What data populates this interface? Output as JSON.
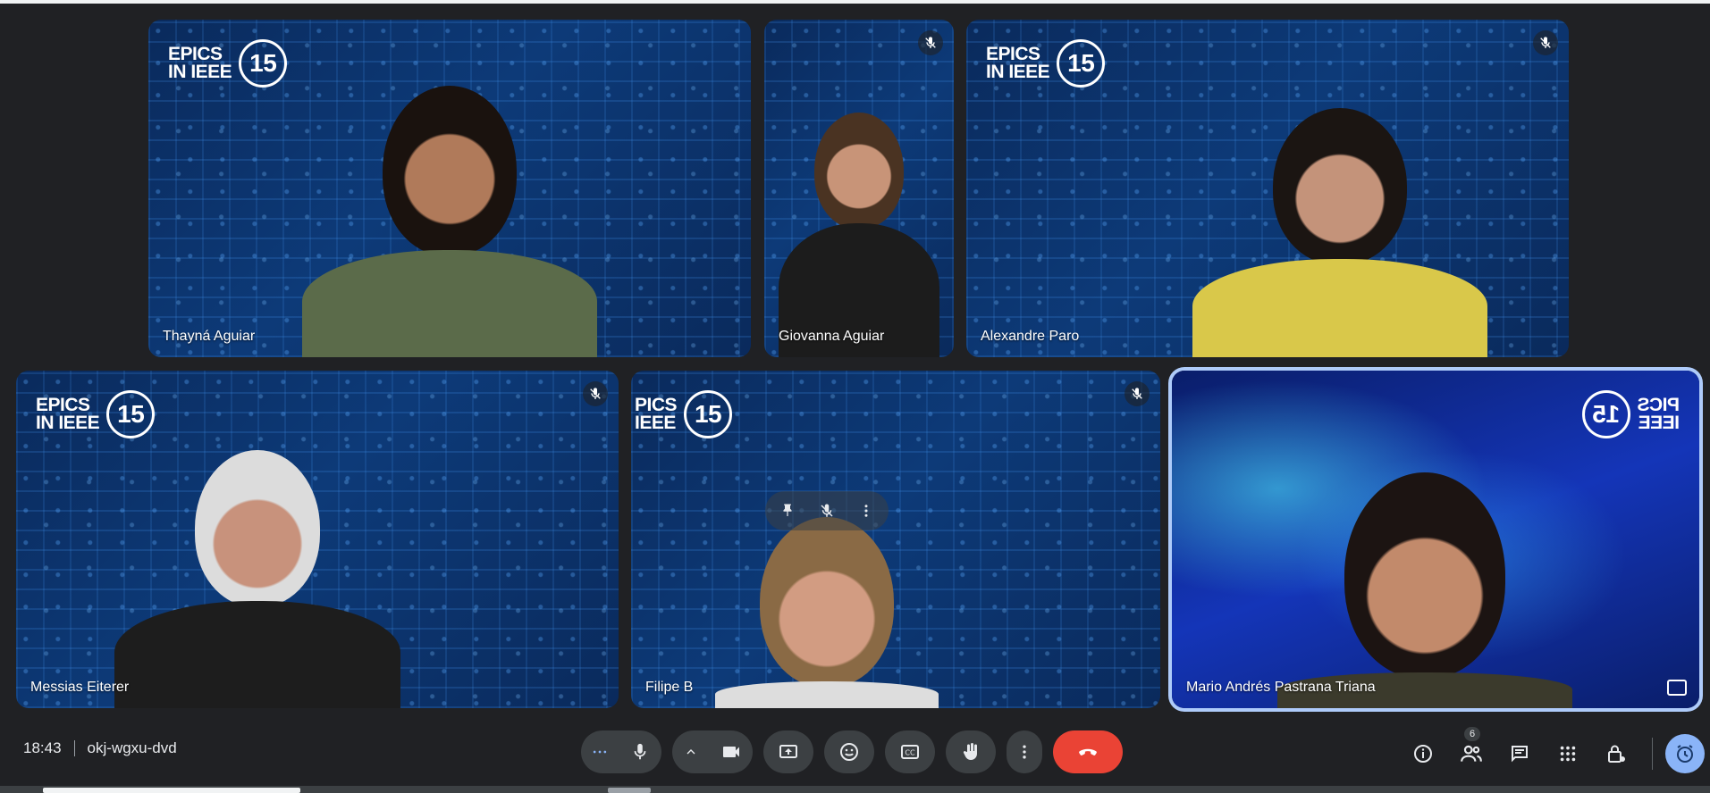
{
  "participants": [
    {
      "name": "Thayná Aguiar",
      "muted": false,
      "logo_top": "EPICS",
      "logo_mid": "IN IEEE",
      "logo_badge": "15"
    },
    {
      "name": "Giovanna Aguiar",
      "muted": true
    },
    {
      "name": "Alexandre Paro",
      "muted": true,
      "logo_top": "EPICS",
      "logo_mid": "IN IEEE",
      "logo_badge": "15"
    },
    {
      "name": "Messias Eiterer",
      "muted": true,
      "logo_top": "EPICS",
      "logo_mid": "IN IEEE",
      "logo_badge": "15"
    },
    {
      "name": "Filipe B",
      "muted": true,
      "logo_top": "PICS",
      "logo_mid": "IEEE",
      "logo_badge": "15"
    },
    {
      "name": "Mario Andrés Pastrana Triana",
      "muted": false,
      "active": true,
      "logo_top": "PICS",
      "logo_mid": "IEEE",
      "logo_badge": "15"
    }
  ],
  "meeting": {
    "time": "18:43",
    "code": "okj-wgxu-dvd"
  },
  "people_count": "6",
  "colors": {
    "leave": "#ea4335",
    "control_bg": "#3c4043",
    "accent": "#8ab4f8"
  },
  "icons": {
    "more_options": "more-horiz-icon",
    "mic": "mic-icon",
    "camera_options": "chevron-up-icon",
    "camera": "videocam-icon",
    "present": "present-screen-icon",
    "reactions": "emoji-icon",
    "captions": "cc-icon",
    "raise_hand": "hand-icon",
    "more": "more-vert-icon",
    "leave": "call-end-icon",
    "info": "info-icon",
    "people": "people-icon",
    "chat": "chat-icon",
    "activities": "apps-icon",
    "host": "lock-person-icon",
    "timer": "timer-icon"
  }
}
